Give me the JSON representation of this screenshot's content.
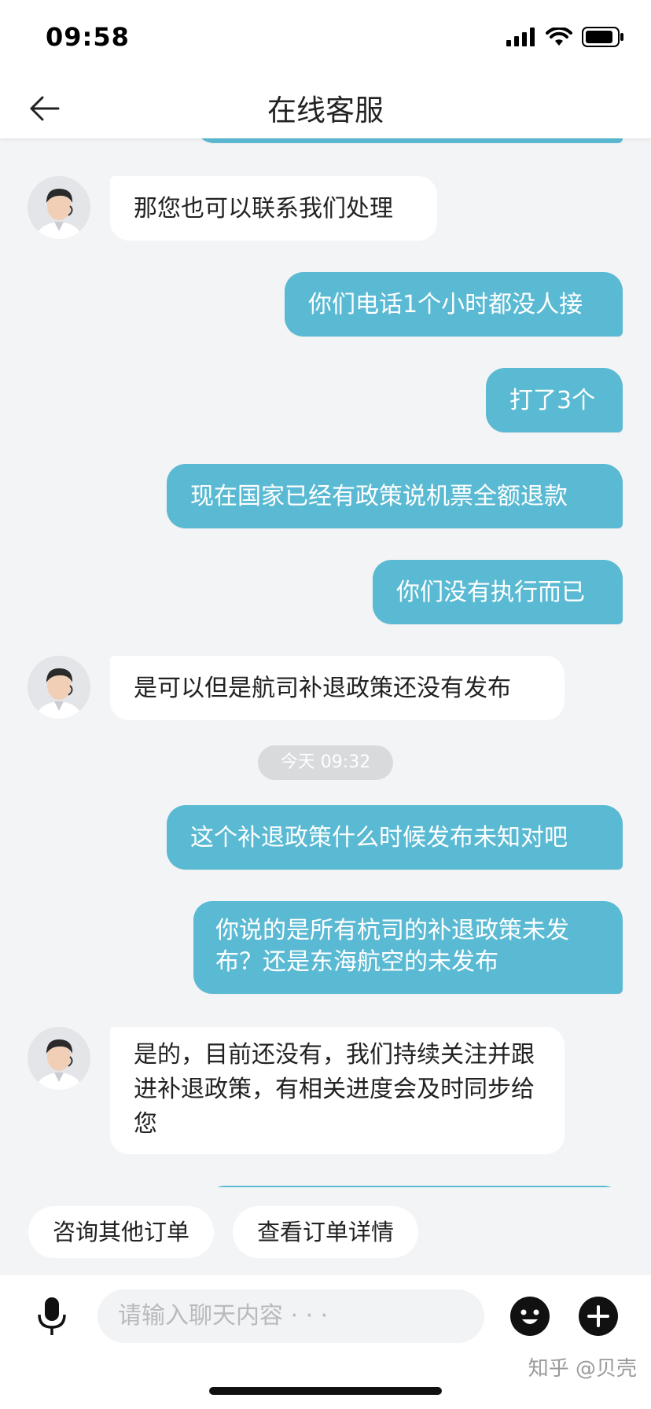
{
  "status": {
    "time": "09:58"
  },
  "nav": {
    "title": "在线客服"
  },
  "messages": [
    {
      "side": "in",
      "text": "那您也可以联系我们处理"
    },
    {
      "side": "out",
      "text": "你们电话1个小时都没人接"
    },
    {
      "side": "out",
      "text": "打了3个"
    },
    {
      "side": "out",
      "text": "现在国家已经有政策说机票全额退款"
    },
    {
      "side": "out",
      "text": "你们没有执行而已"
    },
    {
      "side": "in",
      "text": "是可以但是航司补退政策还没有发布"
    },
    {
      "side": "time",
      "text": "今天 09:32"
    },
    {
      "side": "out",
      "text": "这个补退政策什么时候发布未知对吧"
    },
    {
      "side": "out",
      "text": "你说的是所有杭司的补退政策未发布？还是东海航空的未发布"
    },
    {
      "side": "in",
      "text": "是的，目前还没有，我们持续关注并跟进补退政策，有相关进度会及时同步给您"
    }
  ],
  "quick_replies": [
    "咨询其他订单",
    "查看订单详情"
  ],
  "input": {
    "placeholder": "请输入聊天内容 · · ·"
  },
  "watermark": "知乎 @贝壳",
  "colors": {
    "outgoing_bubble": "#5bbad3",
    "incoming_bubble": "#ffffff",
    "background": "#f3f4f6"
  },
  "icons": [
    "back-arrow-icon",
    "signal-icon",
    "wifi-icon",
    "battery-icon",
    "microphone-icon",
    "emoji-icon",
    "plus-icon"
  ]
}
